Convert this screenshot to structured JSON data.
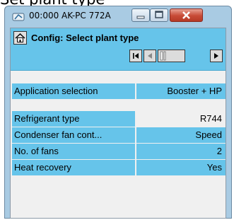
{
  "doc_heading": "Set plant type",
  "window": {
    "title": "00:000 AK-PC 772A",
    "app_icon": "plug-icon",
    "controls": [
      "minimize-icon",
      "maximize-icon",
      "close-icon"
    ]
  },
  "screen": {
    "title": "Config: Select plant type",
    "home_icon": "home-icon",
    "nav_icons": [
      "first-page-icon",
      "previous-page-icon",
      "page-position-icon",
      "next-page-icon"
    ]
  },
  "rows": [
    {
      "label": "Application selection",
      "value": "Booster + HP",
      "editable": true
    },
    {
      "label": "Refrigerant type",
      "value": "R744",
      "editable": false
    },
    {
      "label": "Condenser fan cont...",
      "value": "Speed",
      "editable": true
    },
    {
      "label": "No. of fans",
      "value": "2",
      "editable": true
    },
    {
      "label": "Heat recovery",
      "value": "Yes",
      "editable": true
    }
  ],
  "colors": {
    "accent": "#66c4ea",
    "window_frame": "#a9cbe3",
    "panel": "#f0f0f0",
    "close_button": "#c74a36"
  }
}
